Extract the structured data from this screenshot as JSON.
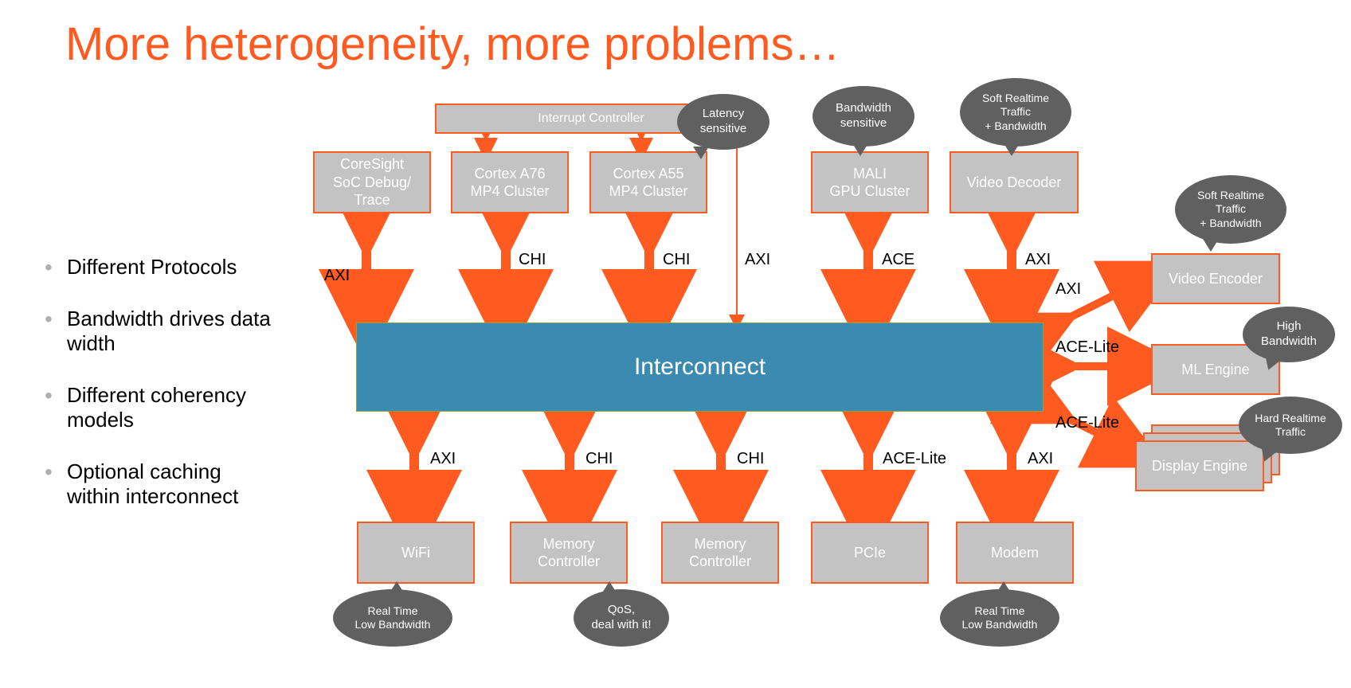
{
  "title": "More heterogeneity, more problems…",
  "bullets": [
    "Different Protocols",
    "Bandwidth drives data width",
    "Different coherency models",
    "Optional caching within interconnect"
  ],
  "interconnect_label": "Interconnect",
  "blocks": {
    "interrupt_controller": "Interrupt Controller",
    "coresight": "CoreSight\nSoC Debug/\nTrace",
    "cortex_a76": "Cortex A76\nMP4 Cluster",
    "cortex_a55": "Cortex A55\nMP4 Cluster",
    "mali": "MALI\nGPU Cluster",
    "video_decoder": "Video Decoder",
    "video_encoder": "Video Encoder",
    "ml_engine": "ML Engine",
    "display_engine": "Display Engine",
    "wifi": "WiFi",
    "memory_controller": "Memory\nController",
    "pcie": "PCIe",
    "modem": "Modem"
  },
  "proto": {
    "axi": "AXI",
    "chi": "CHI",
    "ace": "ACE",
    "ace_lite": "ACE-Lite"
  },
  "bubbles": {
    "latency_sensitive": "Latency\nsensitive",
    "bandwidth_sensitive": "Bandwidth\nsensitive",
    "soft_rt_bw": "Soft Realtime\nTraffic\n+ Bandwidth",
    "high_bw": "High\nBandwidth",
    "hard_rt": "Hard Realtime\nTraffic",
    "real_time_low_bw": "Real Time\nLow Bandwidth",
    "qos": "QoS,\ndeal with it!"
  }
}
